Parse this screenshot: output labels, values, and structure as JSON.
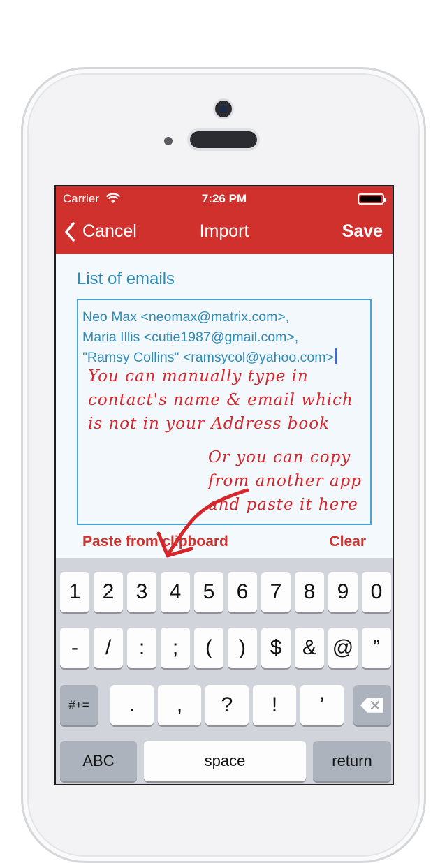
{
  "status_bar": {
    "carrier": "Carrier",
    "time": "7:26 PM"
  },
  "nav": {
    "back_label": "Cancel",
    "title": "Import",
    "save_label": "Save"
  },
  "form": {
    "section_label": "List of emails",
    "emails": [
      "Neo Max <neomax@matrix.com>,",
      "Maria Illis <cutie1987@gmail.com>,",
      "\"Ramsy Collins\" <ramsycol@yahoo.com>"
    ],
    "annotation_manual": "You can manually type in\ncontact's name & email which\nis not in your Address book",
    "annotation_copy": "Or you can copy\nfrom another app\nand paste it here",
    "paste_label": "Paste from clipboard",
    "clear_label": "Clear"
  },
  "keyboard": {
    "row1": [
      "1",
      "2",
      "3",
      "4",
      "5",
      "6",
      "7",
      "8",
      "9",
      "0"
    ],
    "row2": [
      "-",
      "/",
      ":",
      ";",
      "(",
      ")",
      "$",
      "&",
      "@",
      "”"
    ],
    "row3": [
      ".",
      ",",
      "?",
      "!",
      "’"
    ],
    "symbols_label": "#+=",
    "abc_label": "ABC",
    "space_label": "space",
    "return_label": "return"
  },
  "colors": {
    "accent": "#d0312d",
    "link_blue": "#2f8bb8",
    "annotation_red": "#d6262b"
  },
  "icons": {
    "back": "chevron-left-icon",
    "wifi": "wifi-icon",
    "battery": "battery-icon",
    "delete": "backspace-icon"
  }
}
